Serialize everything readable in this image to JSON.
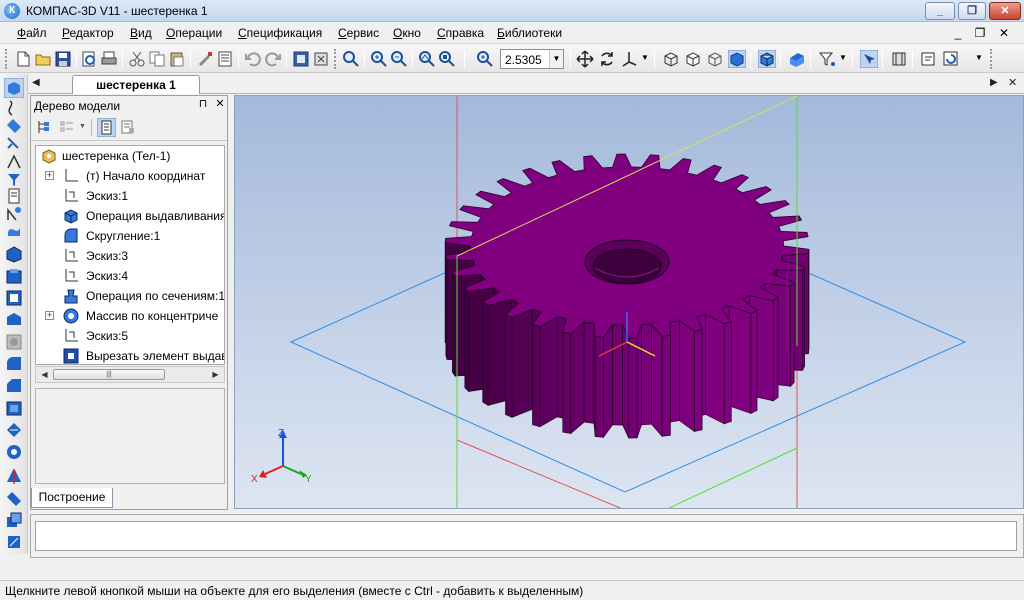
{
  "window": {
    "app_icon_letter": "К",
    "title": "КОМПАС-3D V11 - шестеренка 1"
  },
  "menu": {
    "items": [
      "Файл",
      "Редактор",
      "Вид",
      "Операции",
      "Спецификация",
      "Сервис",
      "Окно",
      "Справка",
      "Библиотеки"
    ]
  },
  "toolbar": {
    "zoom_value": "2.5305"
  },
  "document_tab": {
    "label": "шестеренка 1"
  },
  "model_tree": {
    "title": "Дерево модели",
    "items": [
      {
        "label": "шестеренка (Тел-1)",
        "icon": "part-icon"
      },
      {
        "label": "(т) Начало координат",
        "icon": "origin-icon",
        "expandable": true
      },
      {
        "label": "Эскиз:1",
        "icon": "sketch-icon"
      },
      {
        "label": "Операция выдавливания",
        "icon": "extrude-icon"
      },
      {
        "label": "Скругление:1",
        "icon": "fillet-icon"
      },
      {
        "label": "Эскиз:3",
        "icon": "sketch-icon"
      },
      {
        "label": "Эскиз:4",
        "icon": "sketch-icon"
      },
      {
        "label": "Операция по сечениям:1",
        "icon": "loft-icon"
      },
      {
        "label": "Массив по концентриче",
        "icon": "circular-array-icon",
        "expandable": true
      },
      {
        "label": "Эскиз:5",
        "icon": "sketch-icon"
      },
      {
        "label": "Вырезать элемент выдав",
        "icon": "cut-extrude-icon"
      }
    ],
    "bottom_tab": "Построение"
  },
  "viewport": {
    "axis_x": "X",
    "axis_y": "Y",
    "axis_z": "Z",
    "model_color": "#800080",
    "background_color": "#b5c6e2"
  },
  "status": {
    "text": "Щелкните левой кнопкой мыши на объекте для его выделения (вместе с Ctrl - добавить к выделенным)"
  }
}
